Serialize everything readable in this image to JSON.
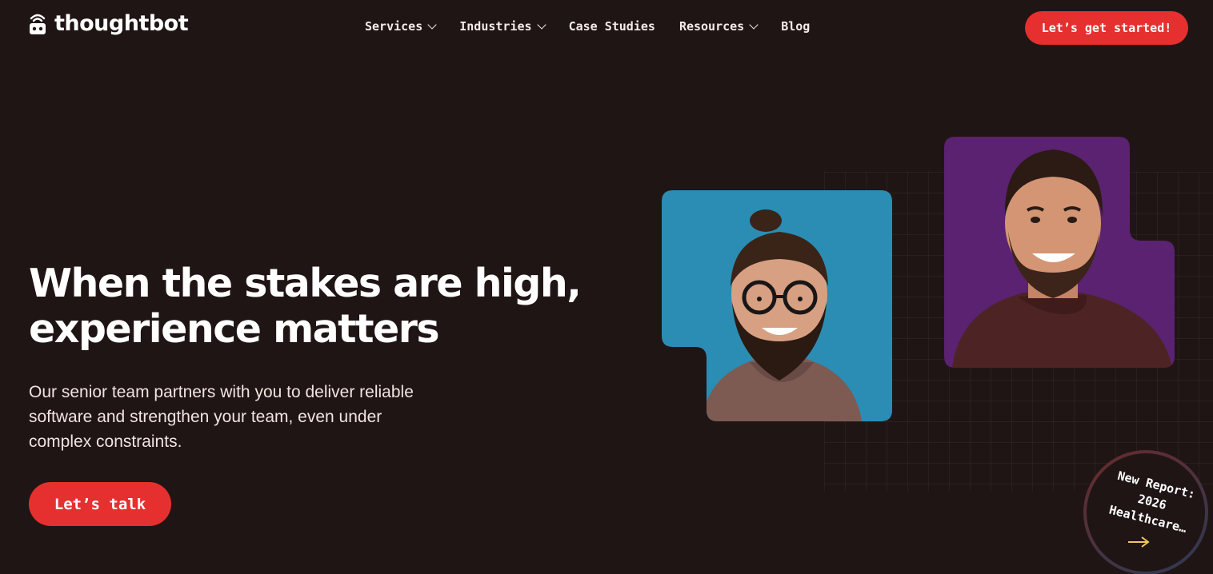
{
  "header": {
    "logo_text": "thoughtbot",
    "nav": [
      {
        "label": "Services",
        "dropdown": true
      },
      {
        "label": "Industries",
        "dropdown": true
      },
      {
        "label": "Case Studies",
        "dropdown": false
      },
      {
        "label": "Resources",
        "dropdown": true
      },
      {
        "label": "Blog",
        "dropdown": false
      }
    ],
    "cta_label": "Let’s get started!"
  },
  "hero": {
    "title_line1": "When the stakes are high,",
    "title_line2": "experience matters",
    "subtitle": "Our senior team partners with you to deliver reliable software and strengthen your team, even under complex constraints.",
    "cta_label": "Let’s talk"
  },
  "badge": {
    "line1": "New Report:",
    "line2": "2026",
    "line3": "Healthcare…"
  },
  "colors": {
    "background": "#201515",
    "accent_red": "#e5302f",
    "photo_blue": "#2b8db3",
    "photo_purple": "#5a2270",
    "arrow_gold": "#f0c860"
  },
  "icons": {
    "logo": "robot-wifi-icon",
    "dropdown": "chevron-down-icon",
    "badge_arrow": "arrow-right-icon"
  }
}
